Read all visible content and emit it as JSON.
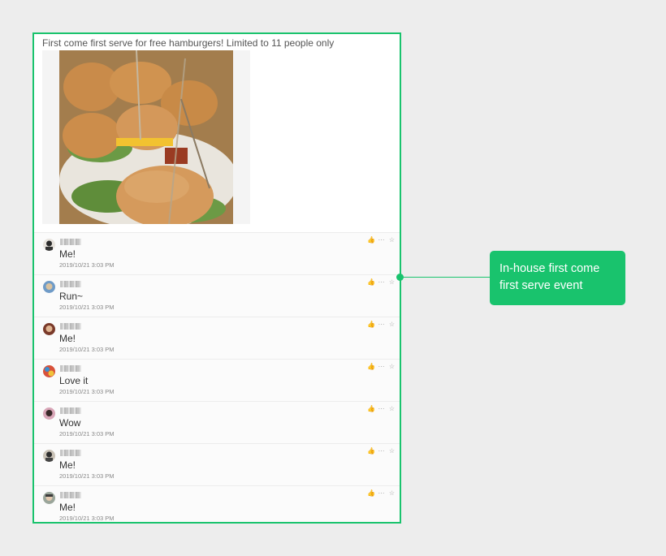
{
  "post": {
    "title": "First come first serve for free hamburgers!  Limited to 11 people only"
  },
  "comments": [
    {
      "text": "Me!",
      "time": "2019/10/21 3:03 PM"
    },
    {
      "text": "Run~",
      "time": "2019/10/21 3:03 PM"
    },
    {
      "text": "Me!",
      "time": "2019/10/21 3:03 PM"
    },
    {
      "text": "Love it",
      "time": "2019/10/21 3:03 PM"
    },
    {
      "text": "Wow",
      "time": "2019/10/21 3:03 PM"
    },
    {
      "text": "Me!",
      "time": "2019/10/21 3:03 PM"
    },
    {
      "text": "Me!",
      "time": "2019/10/21 3:03 PM"
    }
  ],
  "comment_actions": {
    "like": "👍",
    "more": "···",
    "star": "☆"
  },
  "callout": {
    "text": "In-house first come first serve event"
  },
  "colors": {
    "accent": "#19c36d"
  }
}
